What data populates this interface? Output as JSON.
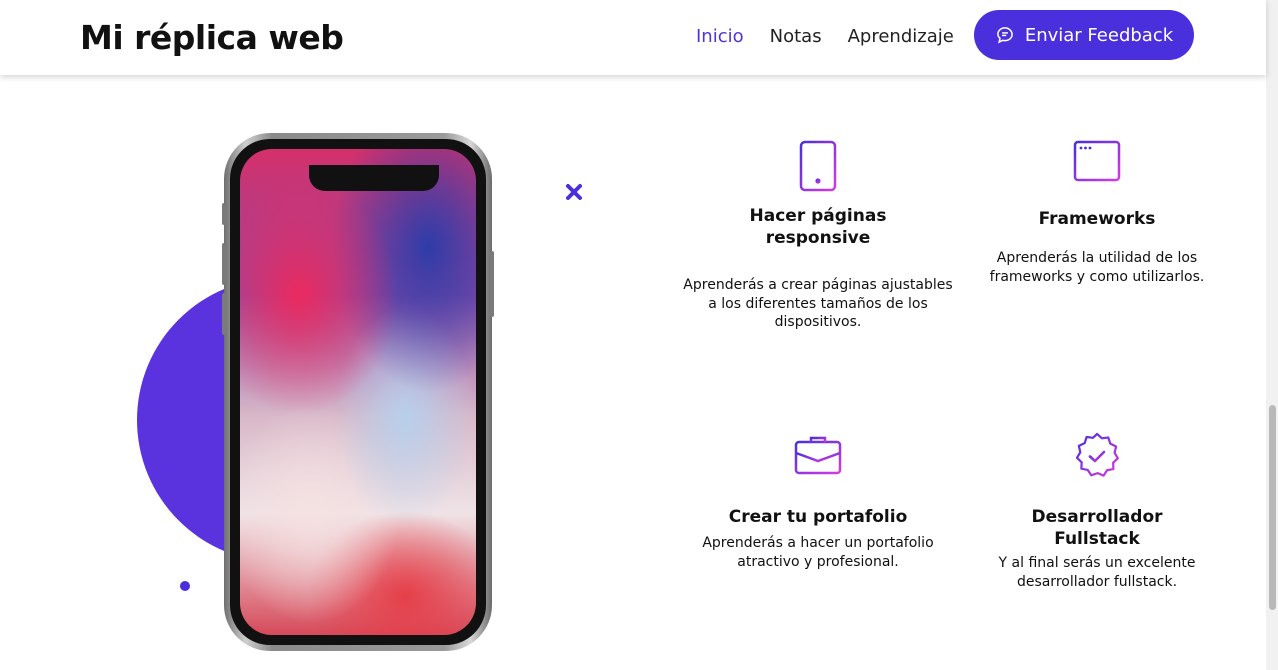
{
  "header": {
    "brand": "Mi réplica web",
    "nav": [
      {
        "label": "Inicio",
        "active": true
      },
      {
        "label": "Notas",
        "active": false
      },
      {
        "label": "Aprendizaje",
        "active": false
      }
    ],
    "feedback_label": "Enviar Feedback"
  },
  "colors": {
    "accent": "#4a2fdc",
    "icon_gradient_start": "#4a2fdc",
    "icon_gradient_end": "#d43be0"
  },
  "features": [
    {
      "icon": "tablet-icon",
      "title": "Hacer páginas responsive",
      "text": "Aprenderás a crear páginas ajustables a los diferentes tamaños de los dispositivos."
    },
    {
      "icon": "browser-window-icon",
      "title": "Frameworks",
      "text": "Aprenderás la utilidad de los frameworks y como utilizarlos."
    },
    {
      "icon": "briefcase-icon",
      "title": "Crear tu portafolio",
      "text": "Aprenderás a hacer un portafolio atractivo y profesional."
    },
    {
      "icon": "verified-badge-icon",
      "title": "Desarrollador Fullstack",
      "text": "Y al final serás un excelente desarrollador fullstack."
    }
  ]
}
